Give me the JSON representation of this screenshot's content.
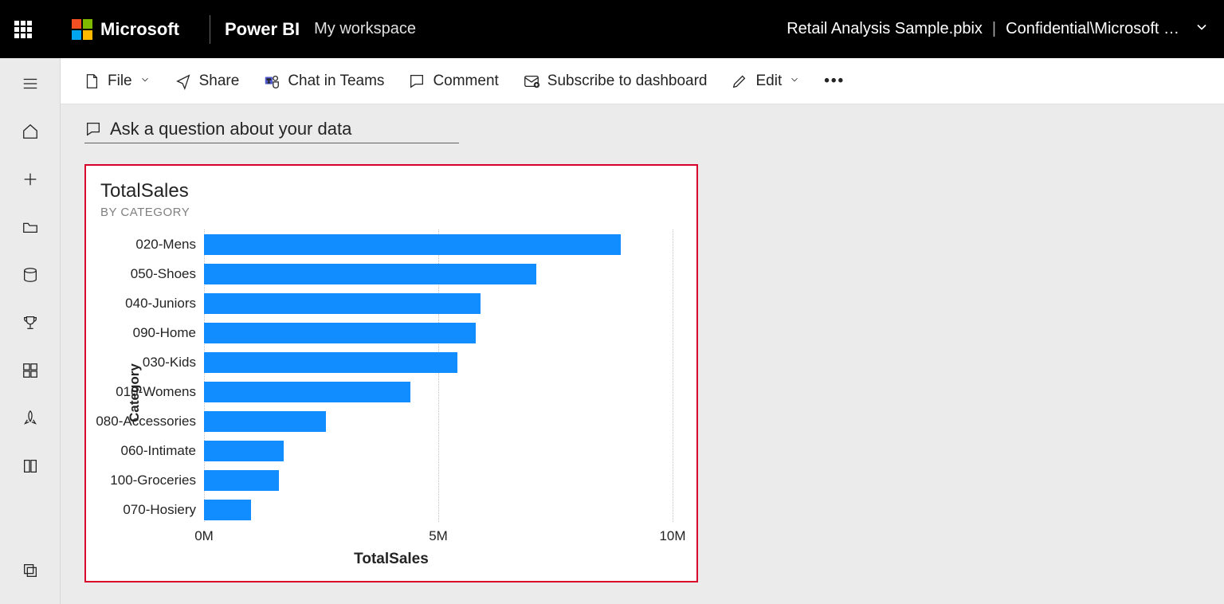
{
  "header": {
    "brand": "Microsoft",
    "product": "Power BI",
    "workspace": "My workspace",
    "file_name": "Retail Analysis Sample.pbix",
    "sensitivity": "Confidential\\Microsoft …"
  },
  "commands": {
    "file": "File",
    "share": "Share",
    "chat_teams": "Chat in Teams",
    "comment": "Comment",
    "subscribe": "Subscribe to dashboard",
    "edit": "Edit"
  },
  "qa_placeholder": "Ask a question about your data",
  "tile": {
    "title": "TotalSales",
    "subtitle": "BY CATEGORY"
  },
  "chart_data": {
    "type": "bar",
    "orientation": "horizontal",
    "title": "TotalSales",
    "subtitle": "BY CATEGORY",
    "xlabel": "TotalSales",
    "ylabel": "Category",
    "xlim": [
      0,
      10
    ],
    "x_unit_suffix": "M",
    "x_ticks": [
      0,
      5,
      10
    ],
    "categories": [
      "020-Mens",
      "050-Shoes",
      "040-Juniors",
      "090-Home",
      "030-Kids",
      "010-Womens",
      "080-Accessories",
      "060-Intimate",
      "100-Groceries",
      "070-Hosiery"
    ],
    "values": [
      8.9,
      7.1,
      5.9,
      5.8,
      5.4,
      4.4,
      2.6,
      1.7,
      1.6,
      1.0
    ],
    "bar_color": "#118dff"
  }
}
